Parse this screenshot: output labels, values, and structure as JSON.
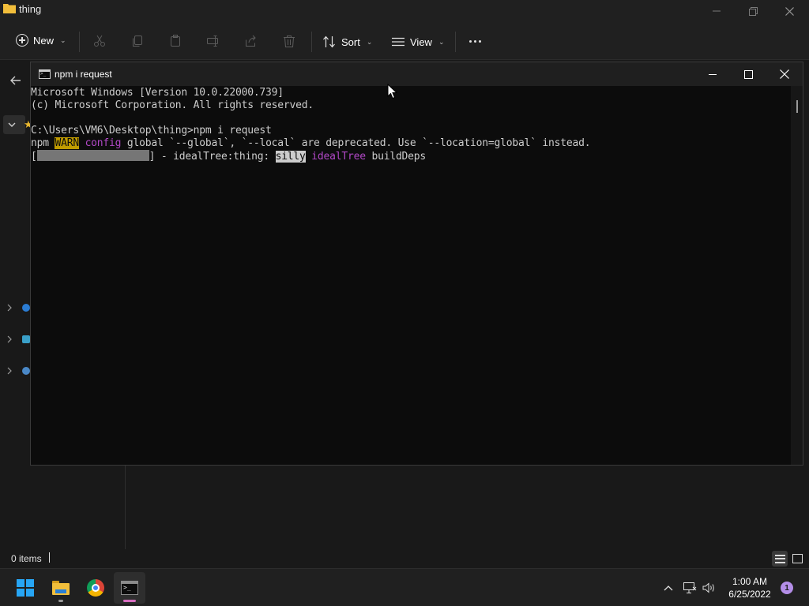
{
  "explorer": {
    "title": "thing",
    "toolbar": {
      "new_label": "New",
      "sort_label": "Sort",
      "view_label": "View",
      "icons": [
        "cut-icon",
        "copy-icon",
        "paste-icon",
        "rename-icon",
        "share-icon",
        "delete-icon",
        "more-icon"
      ]
    },
    "status": {
      "items_text": "0 items"
    }
  },
  "cmd": {
    "title": "npm i request",
    "lines": {
      "l1": "Microsoft Windows [Version 10.0.22000.739]",
      "l2": "(c) Microsoft Corporation. All rights reserved.",
      "l3": "C:\\Users\\VM6\\Desktop\\thing>npm i request",
      "l4_prefix": "npm ",
      "l4_warn": "WARN",
      "l4_space": " ",
      "l4_config": "config",
      "l4_rest": " global `--global`, `--local` are deprecated. Use `--location=global` instead.",
      "l5_open": "[",
      "l5_after": "] - idealTree:thing: ",
      "l5_silly": "silly",
      "l5_space": " ",
      "l5_idealtree": "idealTree",
      "l5_rest": " buildDeps"
    },
    "colors": {
      "background": "#0c0c0c",
      "text": "#cccccc",
      "warn_bg": "#c19c00",
      "magenta": "#b148c6"
    }
  },
  "taskbar": {
    "apps": [
      "start-button",
      "file-explorer",
      "chrome",
      "command-prompt"
    ],
    "clock": {
      "time": "1:00 AM",
      "date": "6/25/2022"
    },
    "notification_count": "1"
  }
}
